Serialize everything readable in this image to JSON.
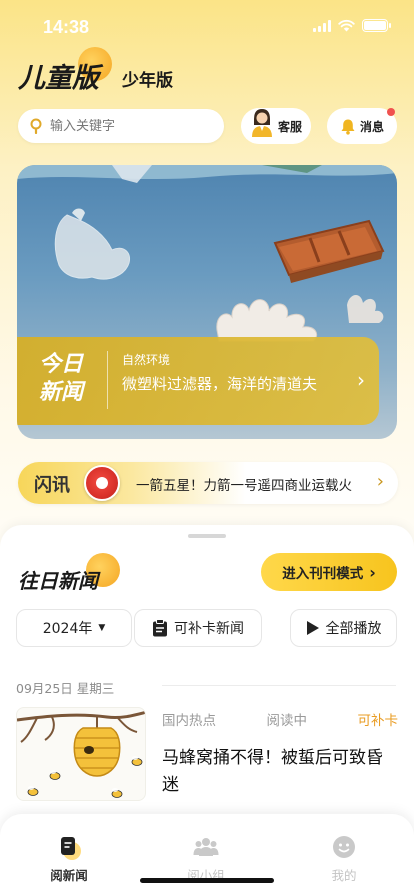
{
  "status": {
    "time": "14:38"
  },
  "header": {
    "brand": "儿童版",
    "sub_brand": "少年版"
  },
  "search": {
    "placeholder": "输入关键字"
  },
  "actions": {
    "service_label": "客服",
    "message_label": "消息"
  },
  "hero": {
    "today_label": "今日新闻",
    "category": "自然环境",
    "headline": "微塑料过滤器，海洋的清道夫"
  },
  "flash": {
    "label": "闪讯",
    "text": "一箭五星！力箭一号遥四商业运载火"
  },
  "past": {
    "title": "往日新闻",
    "magazine_button": "进入刊刊模式",
    "year": "2024年",
    "makeup_news": "可补卡新闻",
    "play_all": "全部播放"
  },
  "feed": {
    "date": "09月25日 星期三",
    "items": [
      {
        "category": "国内热点",
        "status": "阅读中",
        "badge": "可补卡",
        "title": "马蜂窝捅不得！被蜇后可致昏迷"
      }
    ]
  },
  "tabs": [
    {
      "label": "阅新闻",
      "icon": "news-icon"
    },
    {
      "label": "阅小组",
      "icon": "group-icon"
    },
    {
      "label": "我的",
      "icon": "profile-icon"
    }
  ],
  "colors": {
    "accent": "#f7c41e",
    "badge": "#e99c23",
    "notify": "#f0524f"
  }
}
